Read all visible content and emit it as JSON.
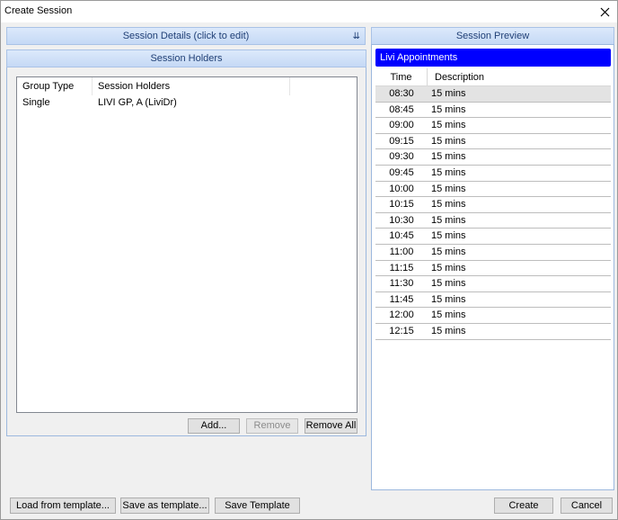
{
  "window": {
    "title": "Create Session"
  },
  "session_details": {
    "header": "Session Details (click to edit)"
  },
  "session_holders": {
    "header": "Session Holders",
    "columns": [
      "Group Type",
      "Session Holders"
    ],
    "rows": [
      {
        "group_type": "Single",
        "holder": "LIVI GP, A (LiviDr)"
      }
    ],
    "buttons": {
      "add": "Add...",
      "remove": "Remove",
      "remove_all": "Remove All"
    }
  },
  "session_preview": {
    "header": "Session Preview",
    "slot_type": "Livi Appointments",
    "columns": [
      "Time",
      "Description"
    ],
    "rows": [
      {
        "time": "08:30",
        "description": "15 mins"
      },
      {
        "time": "08:45",
        "description": "15 mins"
      },
      {
        "time": "09:00",
        "description": "15 mins"
      },
      {
        "time": "09:15",
        "description": "15 mins"
      },
      {
        "time": "09:30",
        "description": "15 mins"
      },
      {
        "time": "09:45",
        "description": "15 mins"
      },
      {
        "time": "10:00",
        "description": "15 mins"
      },
      {
        "time": "10:15",
        "description": "15 mins"
      },
      {
        "time": "10:30",
        "description": "15 mins"
      },
      {
        "time": "10:45",
        "description": "15 mins"
      },
      {
        "time": "11:00",
        "description": "15 mins"
      },
      {
        "time": "11:15",
        "description": "15 mins"
      },
      {
        "time": "11:30",
        "description": "15 mins"
      },
      {
        "time": "11:45",
        "description": "15 mins"
      },
      {
        "time": "12:00",
        "description": "15 mins"
      },
      {
        "time": "12:15",
        "description": "15 mins"
      }
    ]
  },
  "footer": {
    "load_template": "Load from template...",
    "save_as_template": "Save as template...",
    "save_template": "Save Template",
    "create": "Create",
    "cancel": "Cancel"
  },
  "colors": {
    "appt_header_bg": "#0000ff",
    "section_header_text": "#1f3f75"
  },
  "icons": {
    "close": "close-icon",
    "expand": "double-chevron-down-icon"
  }
}
